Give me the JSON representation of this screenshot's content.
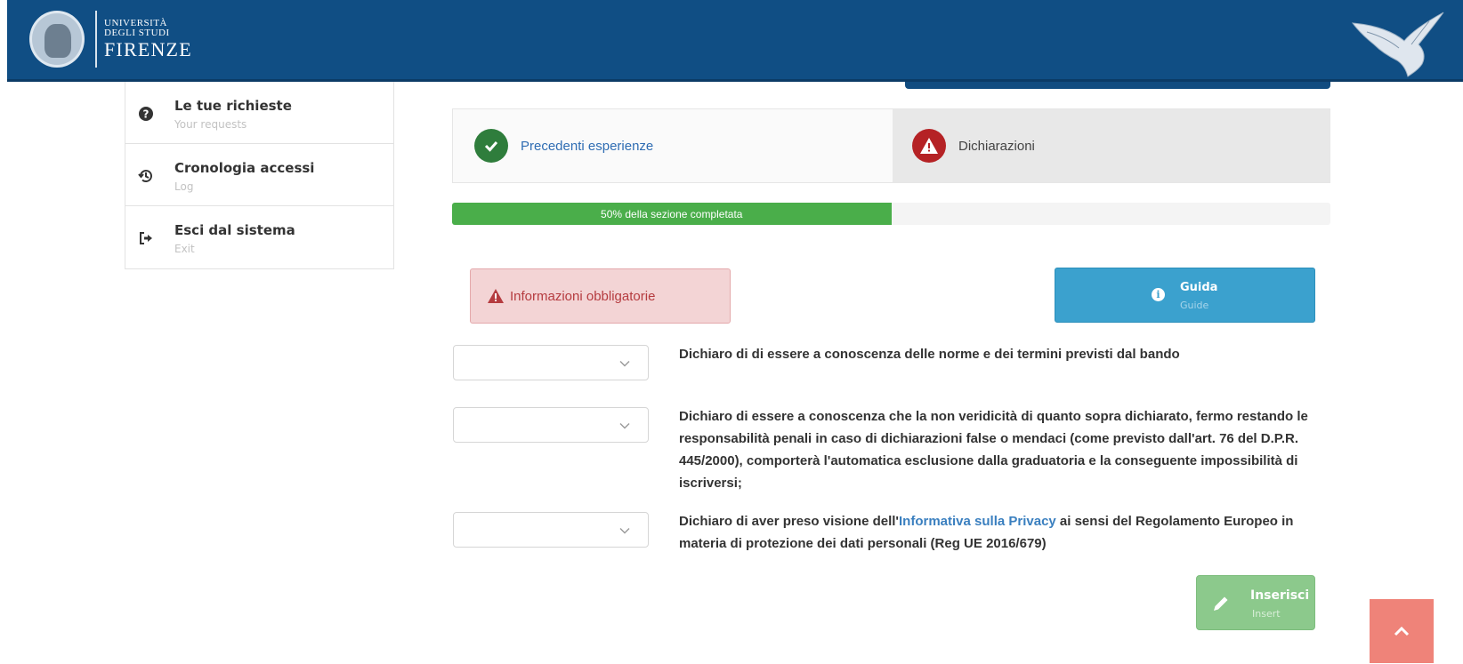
{
  "header": {
    "logo_line1": "UNIVERSITÀ",
    "logo_line2": "DEGLI STUDI",
    "logo_line3": "FIRENZE",
    "seal_icon": "university-seal-icon",
    "eagle_icon": "eagle-icon",
    "background_color": "#104e84"
  },
  "sidebar": {
    "items": [
      {
        "title": "Le tue richieste",
        "subtitle": "Your requests",
        "icon": "question-circle-icon"
      },
      {
        "title": "Cronologia accessi",
        "subtitle": "Log",
        "icon": "history-icon"
      },
      {
        "title": "Esci dal sistema",
        "subtitle": "Exit",
        "icon": "sign-out-icon"
      }
    ]
  },
  "wizard": {
    "steps": [
      {
        "label": "Precedenti esperienze",
        "status": "completed",
        "icon": "check-icon",
        "color": "#2f7d3c"
      },
      {
        "label": "Dichiarazioni",
        "status": "warning",
        "icon": "warning-icon",
        "color": "#b52225"
      }
    ]
  },
  "progress": {
    "label": "50% della sezione completata",
    "value": 0.5,
    "color": "#4aae4a"
  },
  "alerts": {
    "required_label": "Informazioni obbligatorie"
  },
  "guide_button": {
    "label": "Guida",
    "sublabel": "Guide",
    "color": "#3ba1ce"
  },
  "declarations": [
    {
      "select_value": "",
      "text": "Dichiaro di di essere a conoscenza delle norme e dei termini previsti dal bando"
    },
    {
      "select_value": "",
      "text": "Dichiaro di essere a conoscenza che la non veridicità di quanto sopra dichiarato, fermo restando le responsabilità penali in caso di dichiarazioni false o mendaci (come previsto dall'art. 76 del D.P.R. 445/2000), comporterà l'automatica esclusione dalla graduatoria e la conseguente impossibilità di iscriversi;"
    },
    {
      "select_value": "",
      "text_before": "Dichiaro di aver preso visione dell'",
      "link": "Informativa sulla Privacy",
      "text_after": " ai sensi del Regolamento Europeo in materia di protezione dei dati personali (Reg UE 2016/679)"
    }
  ],
  "insert_button": {
    "label": "Inserisci",
    "sublabel": "Insert",
    "color": "#8cc98c"
  },
  "back_to_top": {
    "icon": "chevron-up-icon",
    "color": "#ef8379"
  }
}
